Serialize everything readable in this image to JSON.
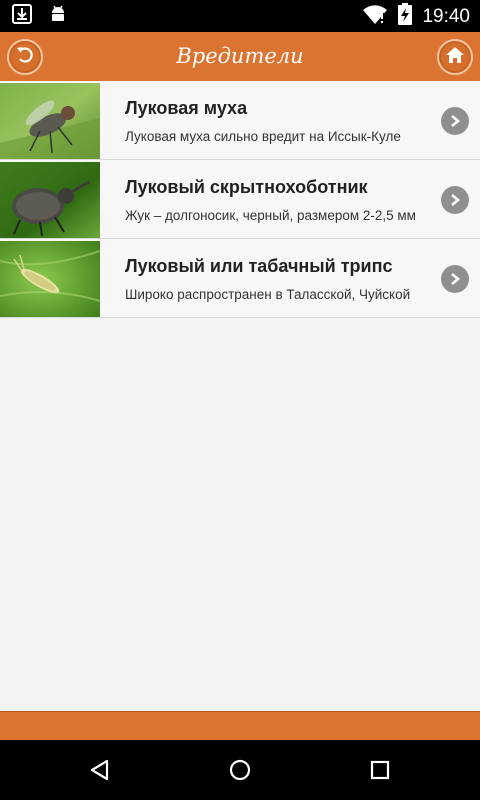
{
  "status_bar": {
    "time": "19:40",
    "icons": [
      "download-icon",
      "android-icon",
      "wifi-icon",
      "battery-charging-icon"
    ]
  },
  "action_bar": {
    "title": "Вредители",
    "back_icon": "back-arrow-icon",
    "home_icon": "home-icon",
    "background": "#dc7431"
  },
  "items": [
    {
      "title": "Луковая муха",
      "description": "Луковая муха сильно вредит на Иссык-Куле",
      "image": "onion-fly-photo"
    },
    {
      "title": "Луковый скрытнохоботник",
      "description": "Жук – долгоносик, черный, размером 2-2,5 мм",
      "image": "weevil-photo"
    },
    {
      "title": "Луковый или табачный трипс",
      "description": "Широко распространен в Таласской, Чуйской",
      "image": "thrips-photo"
    }
  ],
  "nav_bar": {
    "icons": [
      "nav-back-icon",
      "nav-home-icon",
      "nav-recents-icon"
    ]
  }
}
